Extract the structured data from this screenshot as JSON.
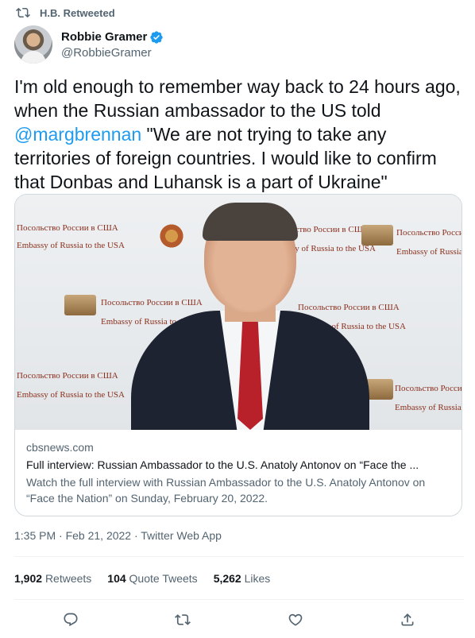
{
  "retweeted_by": "H.B. Retweeted",
  "author": {
    "name": "Robbie Gramer",
    "handle": "@RobbieGramer"
  },
  "tweet": {
    "text_before": "I'm old enough to remember way back to 24 hours ago, when the Russian ambassador to the US told ",
    "mention": "@margbrennan",
    "text_after": " \"We are not trying to take any territories of foreign countries. I would like to confirm that Donbas and Luhansk is a part of Ukraine\""
  },
  "card": {
    "domain": "cbsnews.com",
    "title": "Full interview: Russian Ambassador to the U.S. Anatoly Antonov on “Face the ...",
    "description": "Watch the full interview with Russian Ambassador to the U.S. Anatoly Antonov on “Face the Nation” on Sunday, February 20, 2022.",
    "backdrop_ru": "Посольство России в США",
    "backdrop_en": "Embassy of Russia to the USA"
  },
  "meta": "1:35 PM · Feb 21, 2022 · Twitter Web App",
  "stats": {
    "retweets_count": "1,902",
    "retweets_label": "Retweets",
    "quotes_count": "104",
    "quotes_label": "Quote Tweets",
    "likes_count": "5,262",
    "likes_label": "Likes"
  },
  "icons": {
    "retweet": "retweet-icon",
    "verified": "verified-badge-icon",
    "reply": "reply-icon",
    "like": "heart-icon",
    "share": "share-icon"
  },
  "colors": {
    "accent": "#1d9bf0",
    "text": "#0f1419",
    "secondary": "#536471"
  }
}
